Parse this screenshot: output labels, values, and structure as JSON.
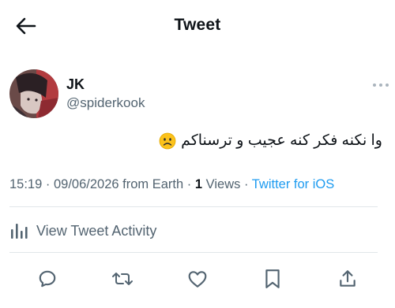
{
  "header": {
    "title": "Tweet",
    "back_icon": "arrow-left-icon"
  },
  "tweet": {
    "author": {
      "display_name": "JK",
      "handle": "@spiderkook"
    },
    "text": "وا نکنه فکر کنه عجیب و ترسناکم",
    "emoji": "😟",
    "time": "15:19",
    "date": "09/06/2026",
    "location": "from Earth",
    "views_count": "1",
    "views_label": "Views",
    "client": "Twitter for iOS"
  },
  "activity": {
    "label": "View Tweet Activity",
    "icon": "bar-chart-icon"
  },
  "actions": [
    {
      "name": "reply",
      "icon": "reply-icon"
    },
    {
      "name": "retweet",
      "icon": "retweet-icon"
    },
    {
      "name": "like",
      "icon": "heart-icon"
    },
    {
      "name": "bookmark",
      "icon": "bookmark-icon"
    },
    {
      "name": "share",
      "icon": "share-icon"
    }
  ],
  "colors": {
    "accent": "#1d9bf0",
    "secondary_text": "#536471",
    "primary_text": "#0f1419",
    "divider": "#e1e6ea"
  }
}
